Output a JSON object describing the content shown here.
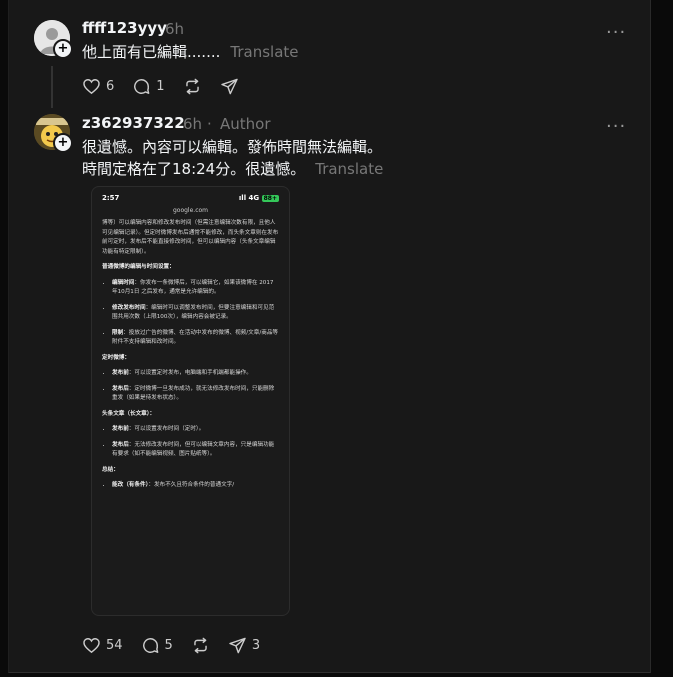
{
  "comments": [
    {
      "username": "ffff123yyy",
      "time": "6h",
      "text": "他上面有已編輯.......",
      "translate": "Translate",
      "likes": "6",
      "replies": "1",
      "reposts": "",
      "shares": ""
    },
    {
      "username": "z362937322",
      "time": "6h",
      "role": "Author",
      "line1": "很遺憾。內容可以編輯。發佈時間無法編輯。",
      "line2": "時間定格在了18:24分。很遺憾。",
      "translate": "Translate",
      "likes": "54",
      "replies": "5",
      "reposts": "",
      "shares": "3"
    }
  ],
  "more_label": "···",
  "plus_label": "+",
  "screenshot": {
    "time": "2:57",
    "signal": "ıll 4G",
    "battery": "88+",
    "url": "google.com",
    "intro": "博等）可以编辑内容和修改发布时间（但需注意编辑次数有限，且他人可见编辑记录）。但定时微博发布后通常不能修改，而头条文章则在发布前可定时，发布后不能直接修改时间，但可以编辑内容（头条文章编辑功能有特定限制）。",
    "section1": "普通微博的编辑与时间设置：",
    "s1_items": [
      {
        "k": "编辑时间",
        "v": "：你发布一条微博后，可以编辑它，如果该微博在 2017年10月1日 之后发布，通常是允许编辑的。"
      },
      {
        "k": "修改发布时间",
        "v": "：编辑时可以调整发布时间，但要注意编辑和可见范围共用次数（上限100次），编辑内容会被记录。"
      },
      {
        "k": "限制",
        "v": "：投放过广告的微博、在活动中发布的微博、视频/文章/商品等附件不支持编辑和改时间。"
      }
    ],
    "section2": "定时微博：",
    "s2_items": [
      {
        "k": "发布前",
        "v": "：可以设置定时发布，电脑端和手机端都能操作。"
      },
      {
        "k": "发布后",
        "v": "：定时微博一旦发布成功，就无法修改发布时间，只能删除重发（如果是待发布状态）。"
      }
    ],
    "section3": "头条文章（长文章）：",
    "s3_items": [
      {
        "k": "发布前",
        "v": "：可以设置发布时间（定时）。"
      },
      {
        "k": "发布后",
        "v": "：无法修改发布时间，但可以编辑文章内容，只是编辑功能有要求（如不能编辑视频、图片贴纸等）。"
      }
    ],
    "section4": "总结：",
    "s4_items": [
      {
        "k": "能改（有条件）",
        "v": "：发布不久且符合条件的普通文字/"
      }
    ]
  }
}
